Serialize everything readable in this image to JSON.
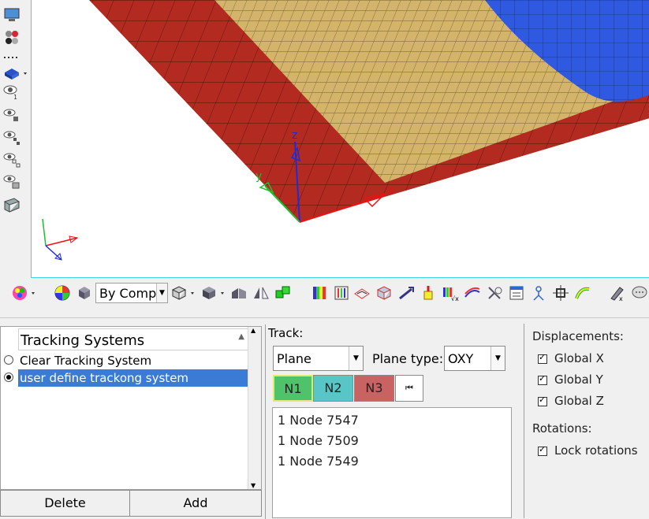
{
  "tracking_systems": {
    "header": "Tracking Systems",
    "items": [
      {
        "label": "Clear Tracking System",
        "selected": false
      },
      {
        "label": "user define trackong system",
        "selected": true
      }
    ],
    "delete_label": "Delete",
    "add_label": "Add"
  },
  "track": {
    "label": "Track:",
    "type_value": "Plane",
    "plane_type_label": "Plane type:",
    "plane_type_value": "OXY",
    "node_buttons": [
      "N1",
      "N2",
      "N3"
    ],
    "nodes": [
      "1 Node 7547",
      "1 Node 7509",
      "1 Node 7549"
    ]
  },
  "displacements": {
    "label": "Displacements:",
    "global_x": "Global X",
    "global_y": "Global Y",
    "global_z": "Global Z",
    "rotations_label": "Rotations:",
    "lock_rotations": "Lock rotations"
  },
  "toolbar": {
    "color_mode": "By Comp"
  },
  "viewport": {
    "axis_x": "x",
    "axis_y": "y",
    "axis_z": "z"
  },
  "colors": {
    "plate_red": "#b22a20",
    "plate_tan": "#d4b46a",
    "sphere_blue": "#2f59e0",
    "selection_blue": "#3a7bd5",
    "n1": "#4ec36a",
    "n2": "#58c6c6",
    "n3": "#c96262"
  }
}
